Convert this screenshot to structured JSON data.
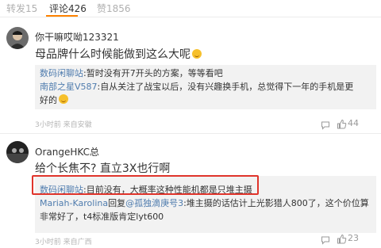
{
  "tabs": [
    {
      "label": "转发15"
    },
    {
      "label": "评论426"
    },
    {
      "label": "赞1856"
    }
  ],
  "comments": [
    {
      "username": "你干嘛哎呦123321",
      "content": "母品牌什么时候能做到这么大呢",
      "replies": [
        {
          "name": "数码闲聊站",
          "text": ":暂时没有开7开头的方案，等等看吧"
        },
        {
          "name": "南部之星V587",
          "text": ":自从关注了战宝以后，没有兴趣换手机，总觉得下一年的手机是更"
        },
        {
          "name": "",
          "text": "好的"
        }
      ],
      "meta": "3小时前 来自安徽",
      "likes": "44"
    },
    {
      "username": "OrangeHKC总",
      "content": "给个长焦不? 直立3X也行啊",
      "replies": [
        {
          "name": "数码闲聊站",
          "text": ":目前没有，大概率这种性能机都是只堆主摄"
        },
        {
          "name": "Mariah-Karolina",
          "text": "回复",
          "mention": "@孤独滴庚号3",
          "tail": ":堆主摄的话估计上光影猎人800了，这个价位算"
        },
        {
          "name": "",
          "text": "非常好了，t4标准版肯定lyt600"
        }
      ],
      "meta": "3小时前 来自广西",
      "likes": "23"
    }
  ],
  "colors": {
    "accent": "#ff8200",
    "reply_name": "#4f7cae",
    "highlight_border": "#e0342b"
  }
}
